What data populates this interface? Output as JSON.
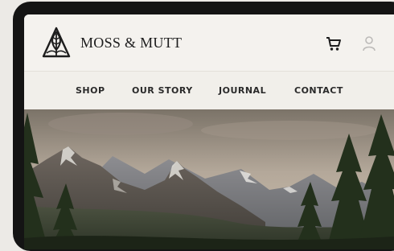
{
  "brand": {
    "name": "MOSS & MUTT",
    "logo_icon": "leaf-tree-logo-icon"
  },
  "header": {
    "cart_icon": "shopping-cart-icon",
    "account_icon": "user-icon"
  },
  "nav": {
    "items": [
      {
        "label": "SHOP"
      },
      {
        "label": "OUR STORY"
      },
      {
        "label": "JOURNAL"
      },
      {
        "label": "CONTACT"
      }
    ]
  },
  "hero": {
    "image": "mountain-forest-landscape"
  },
  "colors": {
    "background": "#f3f1ec",
    "text": "#1d1d1d",
    "frame": "#141414",
    "forest": "#23301c"
  }
}
